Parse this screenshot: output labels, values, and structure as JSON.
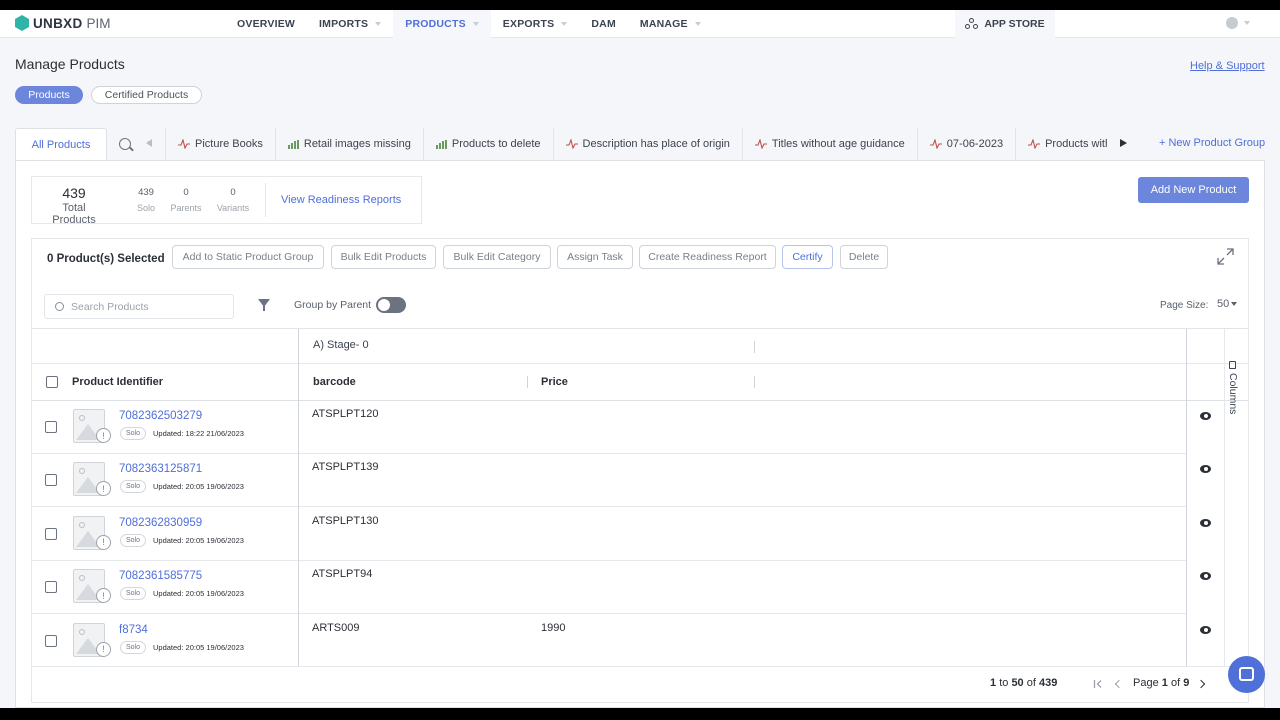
{
  "app": {
    "brand": "UNBXD",
    "product": "PIM"
  },
  "nav": {
    "items": [
      {
        "label": "OVERVIEW",
        "caret": false,
        "active": false
      },
      {
        "label": "IMPORTS",
        "caret": true,
        "active": false
      },
      {
        "label": "PRODUCTS",
        "caret": true,
        "active": true
      },
      {
        "label": "EXPORTS",
        "caret": true,
        "active": false
      },
      {
        "label": "DAM",
        "caret": false,
        "active": false
      },
      {
        "label": "MANAGE",
        "caret": true,
        "active": false
      }
    ],
    "app_store": "APP STORE"
  },
  "page": {
    "title": "Manage Products",
    "help_link": "Help & Support"
  },
  "view_pills": {
    "products": "Products",
    "certified": "Certified Products"
  },
  "group_tabs": {
    "all": "All Products",
    "items": [
      {
        "label": "Picture Books",
        "icon": "pulse"
      },
      {
        "label": "Retail images missing",
        "icon": "bars"
      },
      {
        "label": "Products to delete",
        "icon": "bars"
      },
      {
        "label": "Description has place of origin",
        "icon": "pulse"
      },
      {
        "label": "Titles without age guidance",
        "icon": "pulse"
      },
      {
        "label": "07-06-2023",
        "icon": "pulse"
      },
      {
        "label": "Products with r",
        "icon": "pulse"
      }
    ],
    "new_group": "+ New Product Group"
  },
  "stats": {
    "total_value": "439",
    "total_label": "Total Products",
    "solo_value": "439",
    "solo_label": "Solo",
    "parents_value": "0",
    "parents_label": "Parents",
    "variants_value": "0",
    "variants_label": "Variants",
    "readiness_link": "View Readiness Reports"
  },
  "add_new_button": "Add New Product",
  "actions": {
    "selected": "0 Product(s) Selected",
    "add_static": "Add to Static Product Group",
    "bulk_edit_products": "Bulk Edit Products",
    "bulk_edit_category": "Bulk Edit Category",
    "assign_task": "Assign Task",
    "create_readiness": "Create Readiness Report",
    "certify": "Certify",
    "delete": "Delete"
  },
  "search": {
    "placeholder": "Search Products",
    "value": ""
  },
  "group_by_parent": {
    "label": "Group by Parent",
    "on": false
  },
  "page_size": {
    "label": "Page Size:",
    "value": "50"
  },
  "grid": {
    "group_header": "A) Stage- 0",
    "columns": {
      "identifier": "Product Identifier",
      "barcode": "barcode",
      "price": "Price"
    },
    "columns_panel": "Columns",
    "rows": [
      {
        "id": "7082362503279",
        "badge": "Solo",
        "updated": "Updated: 18:22 21/06/2023",
        "barcode": "ATSPLPT120",
        "price": ""
      },
      {
        "id": "7082363125871",
        "badge": "Solo",
        "updated": "Updated: 20:05 19/06/2023",
        "barcode": "ATSPLPT139",
        "price": ""
      },
      {
        "id": "7082362830959",
        "badge": "Solo",
        "updated": "Updated: 20:05 19/06/2023",
        "barcode": "ATSPLPT130",
        "price": ""
      },
      {
        "id": "7082361585775",
        "badge": "Solo",
        "updated": "Updated: 20:05 19/06/2023",
        "barcode": "ATSPLPT94",
        "price": ""
      },
      {
        "id": "f8734",
        "badge": "Solo",
        "updated": "Updated: 20:05 19/06/2023",
        "barcode": "ARTS009",
        "price": "1990"
      }
    ]
  },
  "pagination": {
    "from": "1",
    "to_word": "to",
    "to": "50",
    "of_word": "of",
    "total": "439",
    "page_word": "Page",
    "page": "1",
    "pages": "9"
  },
  "colors": {
    "accent": "#4f6fd9",
    "button": "#6c86dc",
    "logo": "#2fb5a8"
  }
}
